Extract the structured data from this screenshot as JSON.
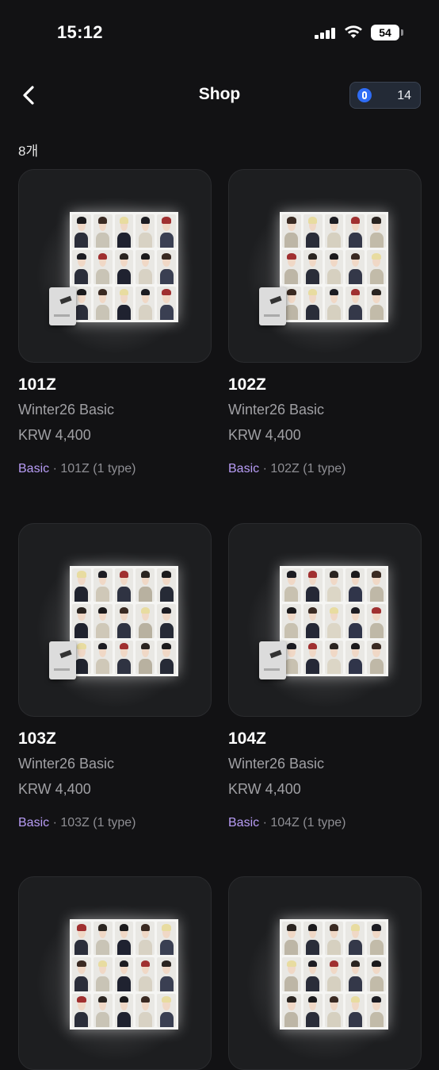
{
  "status": {
    "time": "15:12",
    "battery": "54"
  },
  "nav": {
    "title": "Shop",
    "points": "14"
  },
  "count": "8개",
  "products": [
    {
      "name": "101Z",
      "subtitle": "Winter26 Basic",
      "price": "KRW 4,400",
      "tag": "Basic",
      "detail": "· 101Z (1 type)"
    },
    {
      "name": "102Z",
      "subtitle": "Winter26 Basic",
      "price": "KRW 4,400",
      "tag": "Basic",
      "detail": "· 102Z (1 type)"
    },
    {
      "name": "103Z",
      "subtitle": "Winter26 Basic",
      "price": "KRW 4,400",
      "tag": "Basic",
      "detail": "· 103Z (1 type)"
    },
    {
      "name": "104Z",
      "subtitle": "Winter26 Basic",
      "price": "KRW 4,400",
      "tag": "Basic",
      "detail": "· 104Z (1 type)"
    },
    {
      "name": "",
      "subtitle": "",
      "price": "",
      "tag": "",
      "detail": ""
    },
    {
      "name": "",
      "subtitle": "",
      "price": "",
      "tag": "",
      "detail": ""
    }
  ],
  "colors": {
    "background": "#121214",
    "card": "#1d1e20",
    "tag_purple": "#b79cf5",
    "muted": "#a0a0a4",
    "points_icon": "#2f6df6"
  }
}
